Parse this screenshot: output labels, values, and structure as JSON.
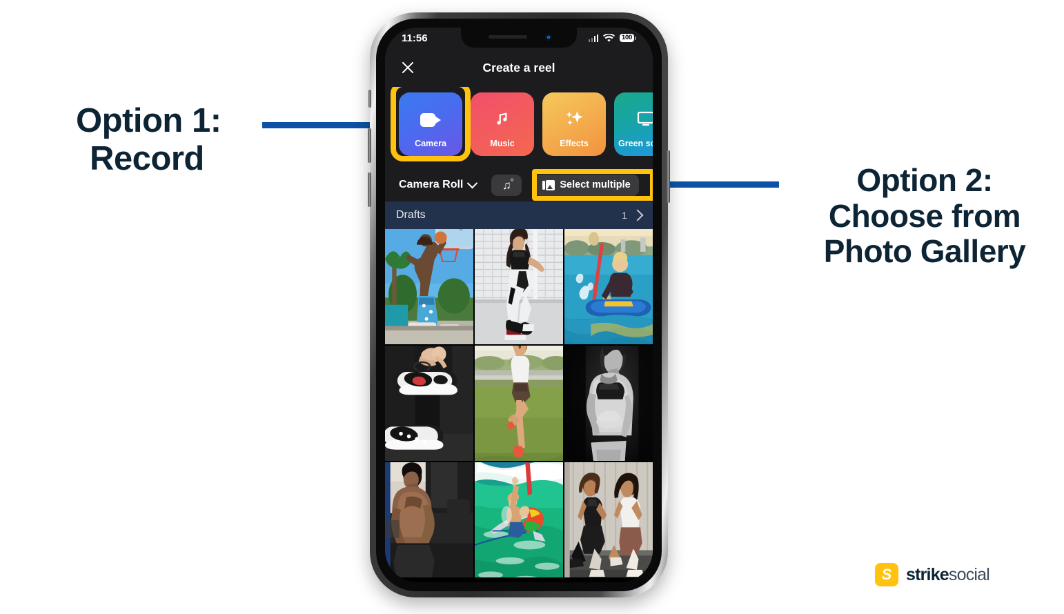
{
  "annotations": {
    "left": {
      "line1": "Option 1:",
      "line2": "Record"
    },
    "right": {
      "line1": "Option 2:",
      "line2": "Choose from",
      "line3": "Photo Gallery"
    },
    "connector_color": "#0d52a6",
    "highlight_color": "#FFC20E"
  },
  "phone": {
    "status_bar": {
      "time": "11:56",
      "signal_icon": "cellular-bars-icon",
      "wifi_icon": "wifi-icon",
      "battery_level": "100"
    },
    "header": {
      "close_icon": "close-icon",
      "title": "Create a reel"
    },
    "tiles": [
      {
        "label": "Camera",
        "icon": "video-camera-icon",
        "highlighted": true
      },
      {
        "label": "Music",
        "icon": "music-note-icon",
        "highlighted": false
      },
      {
        "label": "Effects",
        "icon": "sparkles-icon",
        "highlighted": false
      },
      {
        "label": "Green screen",
        "icon": "green-screen-icon",
        "highlighted": false
      }
    ],
    "picker_bar": {
      "album": "Camera Roll",
      "album_chevron_icon": "chevron-down-icon",
      "audio_button_icon": "music-note-sparkle-icon",
      "select_multiple": "Select multiple",
      "select_multiple_icon": "photo-stack-icon",
      "select_multiple_highlighted": true
    },
    "drafts": {
      "label": "Drafts",
      "count": "1",
      "chevron_icon": "chevron-right-icon"
    },
    "gallery": [
      {
        "name": "basketball-dunk-photo"
      },
      {
        "name": "woman-crouching-gym-photo"
      },
      {
        "name": "kayaker-paddling-photo"
      },
      {
        "name": "sneakers-on-pavement-photo"
      },
      {
        "name": "yoga-tree-pose-photo"
      },
      {
        "name": "bw-fitness-portrait-photo"
      },
      {
        "name": "man-gym-workout-photo"
      },
      {
        "name": "surfer-on-wave-photo"
      },
      {
        "name": "two-women-sitting-wall-photo"
      }
    ]
  },
  "brand": {
    "mark_letter": "S",
    "name_bold": "strike",
    "name_light": "social"
  }
}
